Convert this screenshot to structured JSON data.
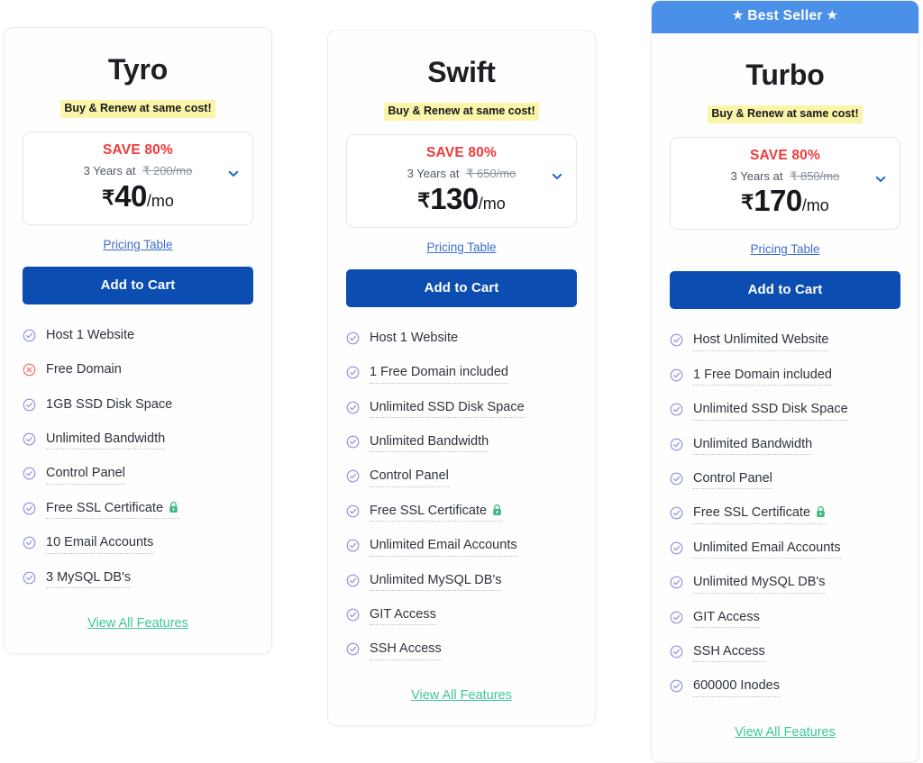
{
  "colors": {
    "best_seller_banner": "#4a90e8",
    "cta_button": "#0b4db0",
    "save_text": "#ef3b3b",
    "highlight": "#fbf5a9",
    "view_all_link": "#3fc79a",
    "pricing_link": "#3c6fd0",
    "check_icon": "#8b8fe0",
    "cross_icon": "#ef6b6b",
    "lock_icon": "#3fb984"
  },
  "plans": [
    {
      "id": "tyro",
      "name": "Tyro",
      "best_seller": false,
      "badge_label": "",
      "renew_note": "Buy & Renew at same cost!",
      "save_label": "SAVE 80%",
      "term_text": "3 Years at",
      "old_price": "₹ 200/mo",
      "currency": "₹",
      "price": "40",
      "per": "/mo",
      "chevron_icon": "chevron-down-icon",
      "pricing_table_label": "Pricing Table",
      "cta_label": "Add to Cart",
      "view_all_label": "View All Features",
      "features": [
        {
          "label": "Host 1 Website",
          "icon": "check-circle-icon",
          "included": true,
          "underline": false
        },
        {
          "label": "Free Domain",
          "icon": "cross-circle-icon",
          "included": false,
          "underline": false
        },
        {
          "label": "1GB SSD Disk Space",
          "icon": "check-circle-icon",
          "included": true,
          "underline": false
        },
        {
          "label": "Unlimited Bandwidth",
          "icon": "check-circle-icon",
          "included": true,
          "underline": true
        },
        {
          "label": "Control Panel",
          "icon": "check-circle-icon",
          "included": true,
          "underline": true
        },
        {
          "label": "Free SSL Certificate",
          "icon": "check-circle-icon",
          "included": true,
          "underline": true,
          "suffix_icon": "lock-icon"
        },
        {
          "label": "10 Email Accounts",
          "icon": "check-circle-icon",
          "included": true,
          "underline": true
        },
        {
          "label": "3 MySQL DB's",
          "icon": "check-circle-icon",
          "included": true,
          "underline": true
        }
      ]
    },
    {
      "id": "swift",
      "name": "Swift",
      "best_seller": false,
      "badge_label": "",
      "renew_note": "Buy & Renew at same cost!",
      "save_label": "SAVE 80%",
      "term_text": "3 Years at",
      "old_price": "₹ 650/mo",
      "currency": "₹",
      "price": "130",
      "per": "/mo",
      "chevron_icon": "chevron-down-icon",
      "pricing_table_label": "Pricing Table",
      "cta_label": "Add to Cart",
      "view_all_label": "View All Features",
      "features": [
        {
          "label": "Host 1 Website",
          "icon": "check-circle-icon",
          "included": true,
          "underline": false
        },
        {
          "label": "1 Free Domain included",
          "icon": "check-circle-icon",
          "included": true,
          "underline": true
        },
        {
          "label": "Unlimited SSD Disk Space",
          "icon": "check-circle-icon",
          "included": true,
          "underline": true
        },
        {
          "label": "Unlimited Bandwidth",
          "icon": "check-circle-icon",
          "included": true,
          "underline": true
        },
        {
          "label": "Control Panel",
          "icon": "check-circle-icon",
          "included": true,
          "underline": true
        },
        {
          "label": "Free SSL Certificate",
          "icon": "check-circle-icon",
          "included": true,
          "underline": true,
          "suffix_icon": "lock-icon"
        },
        {
          "label": "Unlimited Email Accounts",
          "icon": "check-circle-icon",
          "included": true,
          "underline": true
        },
        {
          "label": "Unlimited MySQL DB's",
          "icon": "check-circle-icon",
          "included": true,
          "underline": true
        },
        {
          "label": "GIT Access",
          "icon": "check-circle-icon",
          "included": true,
          "underline": true
        },
        {
          "label": "SSH Access",
          "icon": "check-circle-icon",
          "included": true,
          "underline": true
        }
      ]
    },
    {
      "id": "turbo",
      "name": "Turbo",
      "best_seller": true,
      "badge_label": "Best Seller",
      "renew_note": "Buy & Renew at same cost!",
      "save_label": "SAVE 80%",
      "term_text": "3 Years at",
      "old_price": "₹ 850/mo",
      "currency": "₹",
      "price": "170",
      "per": "/mo",
      "chevron_icon": "chevron-down-icon",
      "pricing_table_label": "Pricing Table",
      "cta_label": "Add to Cart",
      "view_all_label": "View All Features",
      "features": [
        {
          "label": "Host Unlimited Website",
          "icon": "check-circle-icon",
          "included": true,
          "underline": true
        },
        {
          "label": "1 Free Domain included",
          "icon": "check-circle-icon",
          "included": true,
          "underline": true
        },
        {
          "label": "Unlimited SSD Disk Space",
          "icon": "check-circle-icon",
          "included": true,
          "underline": true
        },
        {
          "label": "Unlimited Bandwidth",
          "icon": "check-circle-icon",
          "included": true,
          "underline": true
        },
        {
          "label": "Control Panel",
          "icon": "check-circle-icon",
          "included": true,
          "underline": true
        },
        {
          "label": "Free SSL Certificate",
          "icon": "check-circle-icon",
          "included": true,
          "underline": true,
          "suffix_icon": "lock-icon"
        },
        {
          "label": "Unlimited Email Accounts",
          "icon": "check-circle-icon",
          "included": true,
          "underline": true
        },
        {
          "label": "Unlimited MySQL DB's",
          "icon": "check-circle-icon",
          "included": true,
          "underline": true
        },
        {
          "label": "GIT Access",
          "icon": "check-circle-icon",
          "included": true,
          "underline": true
        },
        {
          "label": "SSH Access",
          "icon": "check-circle-icon",
          "included": true,
          "underline": true
        },
        {
          "label": "600000 Inodes",
          "icon": "check-circle-icon",
          "included": true,
          "underline": true
        }
      ]
    }
  ]
}
